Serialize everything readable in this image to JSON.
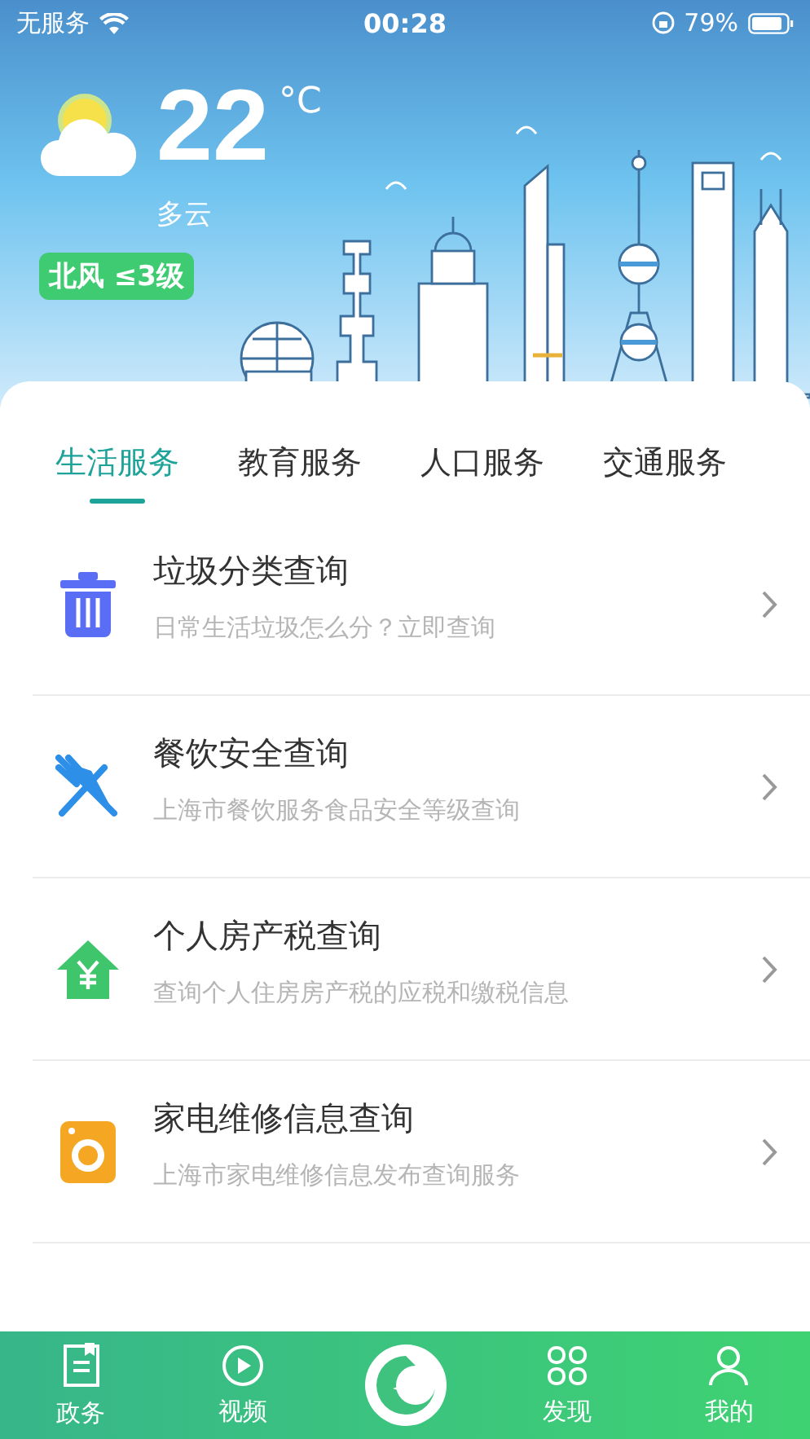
{
  "status_bar": {
    "carrier": "无服务",
    "time": "00:28",
    "battery": "79%"
  },
  "weather": {
    "temperature": "22",
    "unit": "°C",
    "condition": "多云",
    "wind": "北风 ≤3级"
  },
  "tabs": [
    {
      "label": "生活服务",
      "selected": true
    },
    {
      "label": "教育服务",
      "selected": false
    },
    {
      "label": "人口服务",
      "selected": false
    },
    {
      "label": "交通服务",
      "selected": false
    }
  ],
  "services": [
    {
      "kind": "trash",
      "color": "#5a6ef5",
      "title": "垃圾分类查询",
      "subtitle": "日常生活垃圾怎么分？立即查询"
    },
    {
      "kind": "cutlery",
      "color": "#2d8fe8",
      "title": "餐饮安全查询",
      "subtitle": "上海市餐饮服务食品安全等级查询"
    },
    {
      "kind": "house",
      "color": "#3fc56b",
      "title": "个人房产税查询",
      "subtitle": "查询个人住房房产税的应税和缴税信息"
    },
    {
      "kind": "appliance",
      "color": "#f5a623",
      "title": "家电维修信息查询",
      "subtitle": "上海市家电维修信息发布查询服务"
    }
  ],
  "bottom_tabs": [
    {
      "kind": "doc",
      "label": "政务"
    },
    {
      "kind": "play",
      "label": "视频"
    },
    {
      "kind": "logo"
    },
    {
      "kind": "grid",
      "label": "发现"
    },
    {
      "kind": "user",
      "label": "我的"
    }
  ]
}
